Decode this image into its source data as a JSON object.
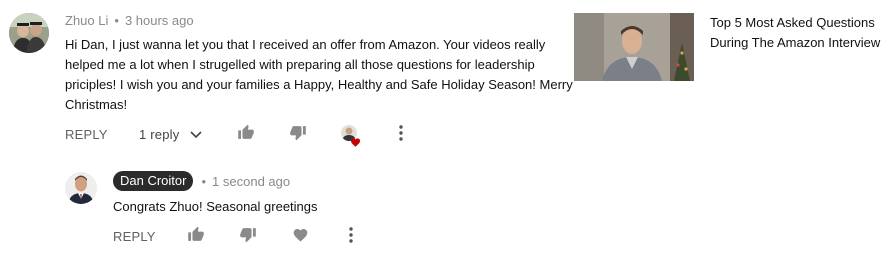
{
  "comment": {
    "author": "Zhuo Li",
    "timestamp": "3 hours ago",
    "text": "Hi Dan, I just wanna let you that I received an offer from Amazon. Your videos really helped me a lot when I strugelled with preparing all those questions for leadership priciples!  I wish you and your families a Happy, Healthy and Safe Holiday Season! Merry Christmas!",
    "reply_label": "REPLY",
    "replies_toggle": "1 reply",
    "icons": [
      "thumbs-up-icon",
      "thumbs-down-icon",
      "creator-heart-icon",
      "more-vert-icon"
    ]
  },
  "reply": {
    "author": "Dan Croitor",
    "timestamp": "1 second ago",
    "text": "Congrats Zhuo! Seasonal greetings",
    "reply_label": "REPLY",
    "icons": [
      "thumbs-up-icon",
      "thumbs-down-icon",
      "heart-icon",
      "more-vert-icon"
    ]
  },
  "video": {
    "title": "Top 5 Most Asked Questions During The Amazon Interview"
  },
  "separator": "•",
  "colors": {
    "heart": "#cc0000",
    "badge_bg": "#2b2b2b",
    "meta_text": "#8a8a8a"
  }
}
